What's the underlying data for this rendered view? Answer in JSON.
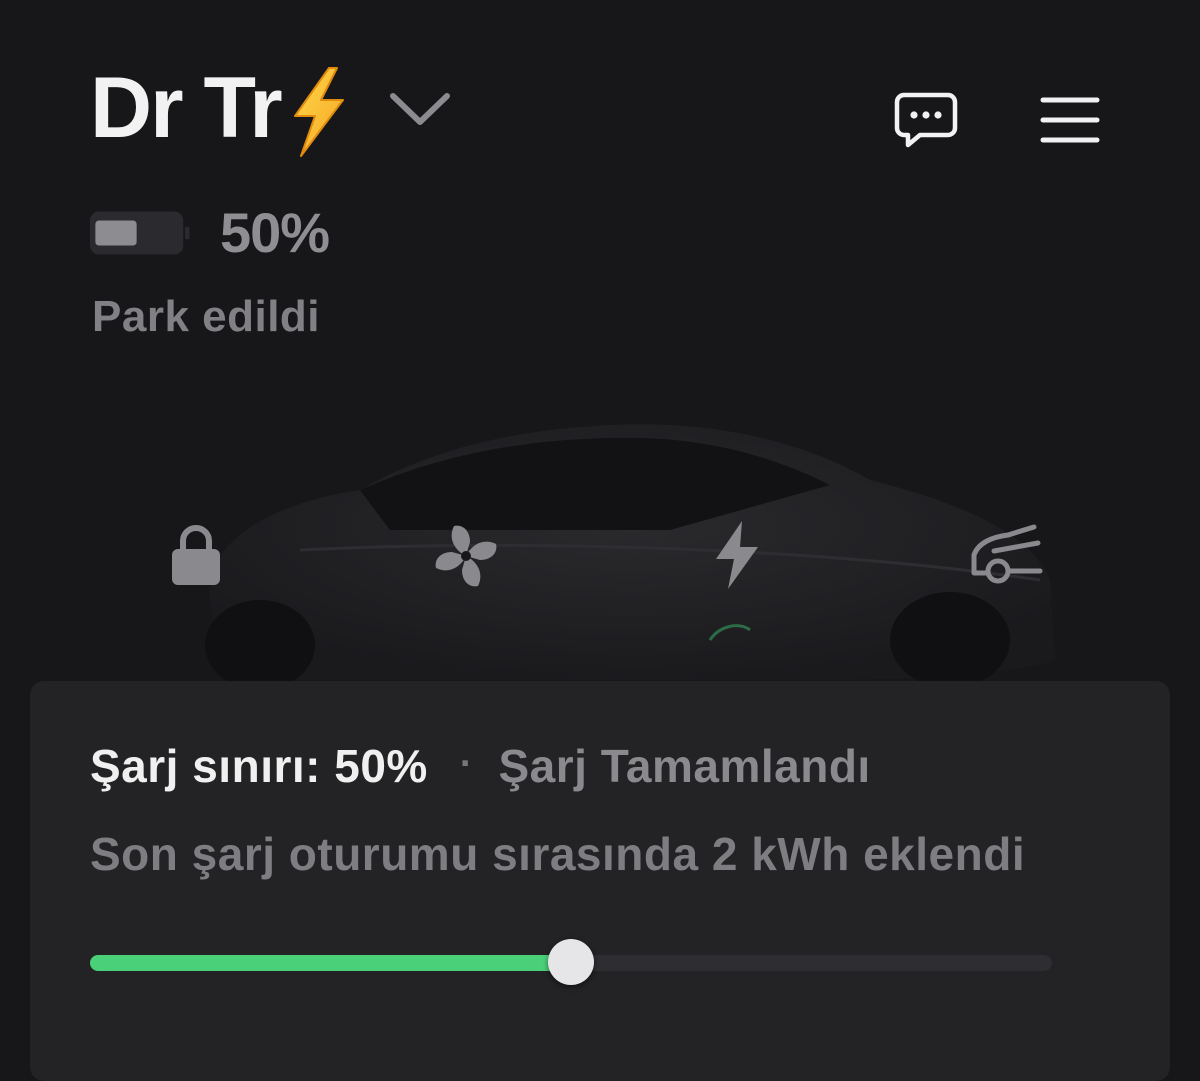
{
  "header": {
    "vehicle_name": "Dr Tr",
    "name_emoji_icon": "high-voltage-emoji",
    "selector_icon": "chevron-down-icon"
  },
  "top_actions": {
    "messages_icon": "chat-bubble-icon",
    "menu_icon": "hamburger-menu-icon"
  },
  "battery": {
    "percent_label": "50%",
    "level": 0.5
  },
  "status": {
    "label": "Park edildi"
  },
  "controls": [
    {
      "icon": "lock-icon"
    },
    {
      "icon": "fan-icon"
    },
    {
      "icon": "charge-bolt-icon"
    },
    {
      "icon": "trunk-open-icon"
    }
  ],
  "charge_panel": {
    "limit_label": "Şarj sınırı: 50%",
    "separator": "·",
    "charge_status": "Şarj Tamamlandı",
    "session_text": "Son şarj oturumu sırasında 2 kWh eklendi",
    "limit_fraction": 0.5
  },
  "colors": {
    "background": "#17171a",
    "panel": "#232325",
    "accent_green": "#4bd07a"
  }
}
